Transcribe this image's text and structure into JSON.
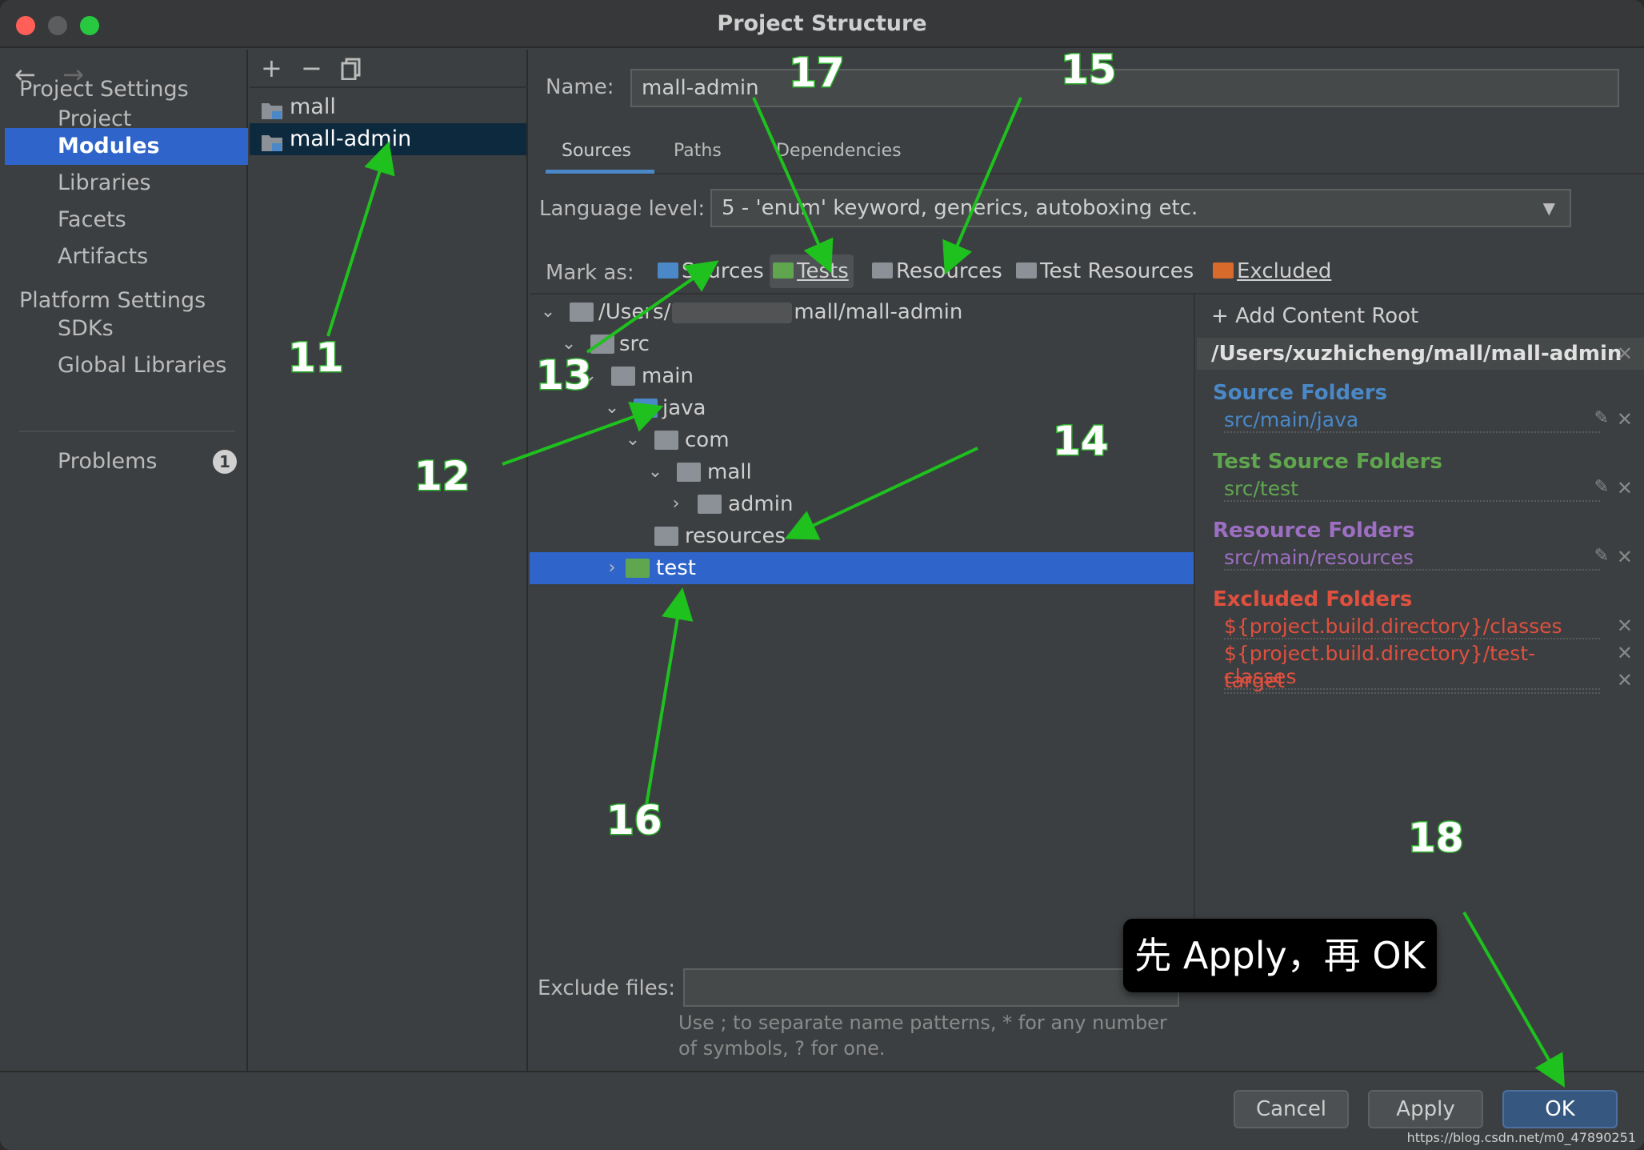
{
  "window": {
    "title": "Project Structure"
  },
  "colors": {
    "selection": "#2f65ca",
    "sources": "#4a88c7",
    "tests": "#5fa64f",
    "resources": "#b07fd3",
    "excluded": "#e0503f",
    "annotation": "#1ec11e"
  },
  "nav": {
    "back_icon": "arrow-left-icon",
    "forward_icon": "arrow-right-icon",
    "project_settings": "Project Settings",
    "platform_settings": "Platform Settings",
    "items": [
      {
        "label": "Project"
      },
      {
        "label": "Modules",
        "selected": true
      },
      {
        "label": "Libraries"
      },
      {
        "label": "Facets"
      },
      {
        "label": "Artifacts"
      },
      {
        "label": "SDKs"
      },
      {
        "label": "Global Libraries"
      }
    ],
    "problems": {
      "label": "Problems",
      "count": "1"
    }
  },
  "modules": {
    "toolbar": {
      "add": "+",
      "remove": "−",
      "copy_icon": "copy-icon"
    },
    "items": [
      {
        "label": "mall"
      },
      {
        "label": "mall-admin",
        "selected": true
      }
    ]
  },
  "content": {
    "name_label": "Name:",
    "name_value": "mall-admin",
    "tabs": [
      "Sources",
      "Paths",
      "Dependencies"
    ],
    "active_tab": "Sources",
    "language_label": "Language level:",
    "language_value": "5 - 'enum' keyword, generics, autoboxing etc.",
    "mark_as_label": "Mark as:",
    "mark_as": [
      "Sources",
      "Tests",
      "Resources",
      "Test Resources",
      "Excluded"
    ],
    "tree": [
      {
        "prefix": "/Users/",
        "suffix": "mall/mall-admin",
        "expanded": true
      },
      {
        "label": "src",
        "expanded": true
      },
      {
        "label": "main",
        "expanded": true
      },
      {
        "label": "java",
        "expanded": true
      },
      {
        "label": "com",
        "expanded": true
      },
      {
        "label": "mall",
        "expanded": true
      },
      {
        "label": "admin",
        "expanded": false
      },
      {
        "label": "resources"
      },
      {
        "label": "test",
        "expanded": false,
        "selected": true
      }
    ],
    "exclude_label": "Exclude files:",
    "exclude_value": "",
    "hint": "Use ; to separate name patterns, * for any number of symbols, ? for one."
  },
  "roots": {
    "add_root": "Add Content Root",
    "root_path": "/Users/xuzhicheng/mall/mall-admin",
    "source_head": "Source Folders",
    "source_path": "src/main/java",
    "test_head": "Test Source Folders",
    "test_path": "src/test",
    "resource_head": "Resource Folders",
    "resource_path": "src/main/resources",
    "excluded_head": "Excluded Folders",
    "excluded_paths": [
      "${project.build.directory}/classes",
      "${project.build.directory}/test-classes",
      "target"
    ]
  },
  "buttons": {
    "cancel": "Cancel",
    "apply": "Apply",
    "ok": "OK"
  },
  "annotations": {
    "numbers": [
      "11",
      "12",
      "13",
      "14",
      "15",
      "16",
      "17",
      "18"
    ],
    "callout": "先 Apply，再 OK"
  },
  "watermark": "https://blog.csdn.net/m0_47890251"
}
